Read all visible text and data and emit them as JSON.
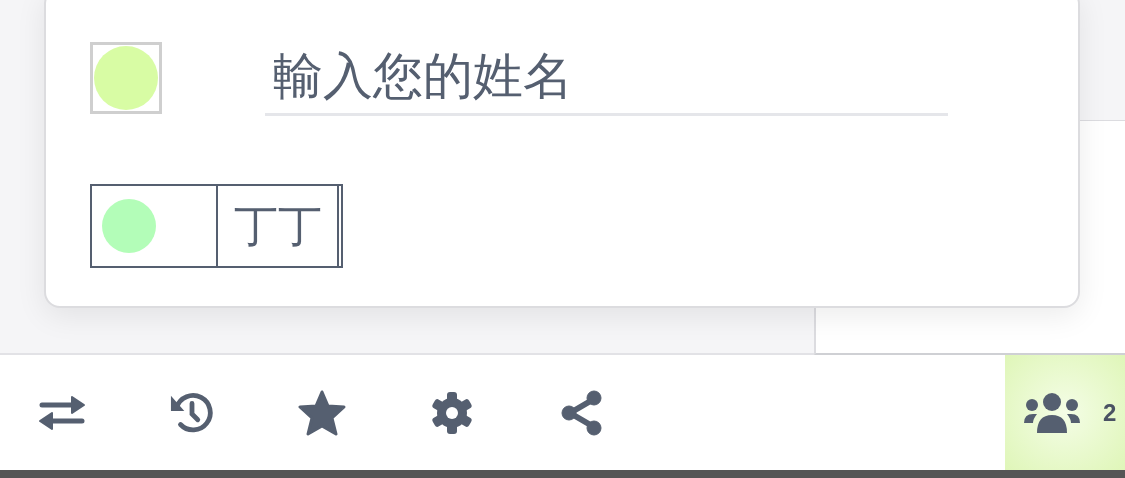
{
  "name_form": {
    "swatch": {
      "color": "#d8fca4"
    },
    "name_input": {
      "placeholder": "輸入您的姓名"
    }
  },
  "players": [
    {
      "color": "#b3fdb8",
      "name": "丁丁"
    }
  ],
  "users_button": {
    "count": "2"
  }
}
